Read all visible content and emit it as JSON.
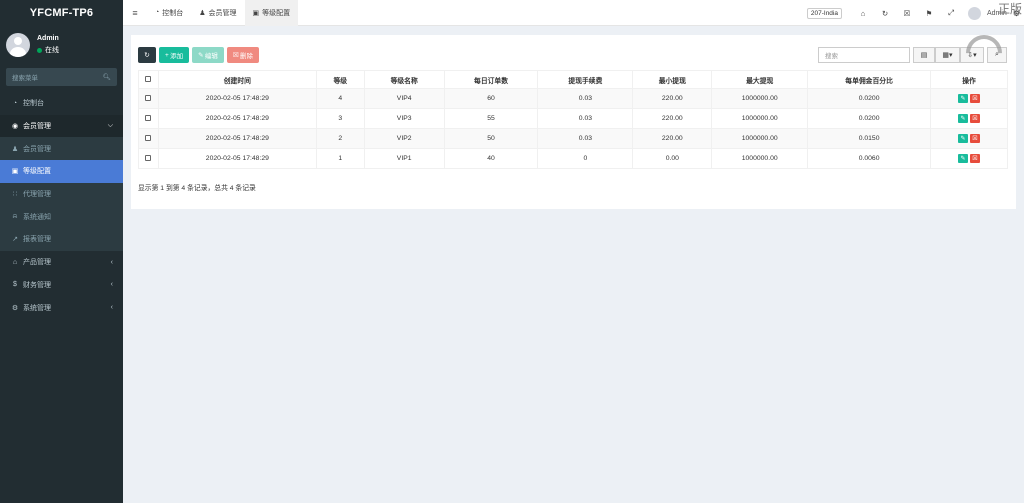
{
  "app": {
    "logo": "YFCMF-TP6"
  },
  "user": {
    "name": "Admin",
    "status": "在线"
  },
  "sidebar": {
    "search_placeholder": "搜索菜单",
    "items": [
      {
        "icon": "dashboard-icon",
        "label": "控制台"
      },
      {
        "icon": "user-circle-icon",
        "label": "会员管理",
        "open": true
      },
      {
        "icon": "user-icon",
        "label": "会员管理",
        "sub": true
      },
      {
        "icon": "id-card-icon",
        "label": "等级配置",
        "sub": true,
        "active": true
      },
      {
        "icon": "sitemap-icon",
        "label": "代理管理",
        "sub": true
      },
      {
        "icon": "bell-icon",
        "label": "系统通知",
        "sub": true
      },
      {
        "icon": "chart-line-icon",
        "label": "报表管理",
        "sub": true
      },
      {
        "icon": "home-icon",
        "label": "产品管理"
      },
      {
        "icon": "dollar-icon",
        "label": "财务管理"
      },
      {
        "icon": "cogs-icon",
        "label": "系统管理"
      }
    ]
  },
  "topbar": {
    "tabs": [
      {
        "icon": "dashboard-icon",
        "label": "控制台"
      },
      {
        "icon": "user-icon",
        "label": "会员管理"
      },
      {
        "icon": "id-card-icon",
        "label": "等级配置",
        "active": true
      }
    ],
    "server": "207-India",
    "user": "Admin",
    "watermark": "正版"
  },
  "toolbar": {
    "add": "添加",
    "edit": "编辑",
    "delete": "删除",
    "search_placeholder": "搜索"
  },
  "table": {
    "columns": [
      "创建时间",
      "等级",
      "等级名称",
      "每日订单数",
      "提现手续费",
      "最小提现",
      "最大提现",
      "每单佣金百分比",
      "操作"
    ],
    "rows": [
      [
        "2020-02-05 17:48:29",
        "4",
        "VIP4",
        "60",
        "0.03",
        "220.00",
        "1000000.00",
        "0.0200"
      ],
      [
        "2020-02-05 17:48:29",
        "3",
        "VIP3",
        "55",
        "0.03",
        "220.00",
        "1000000.00",
        "0.0200"
      ],
      [
        "2020-02-05 17:48:29",
        "2",
        "VIP2",
        "50",
        "0.03",
        "220.00",
        "1000000.00",
        "0.0150"
      ],
      [
        "2020-02-05 17:48:29",
        "1",
        "VIP1",
        "40",
        "0",
        "0.00",
        "1000000.00",
        "0.0060"
      ]
    ]
  },
  "pager": {
    "text": "显示第 1 到第 4 条记录，总共 4 条记录"
  }
}
